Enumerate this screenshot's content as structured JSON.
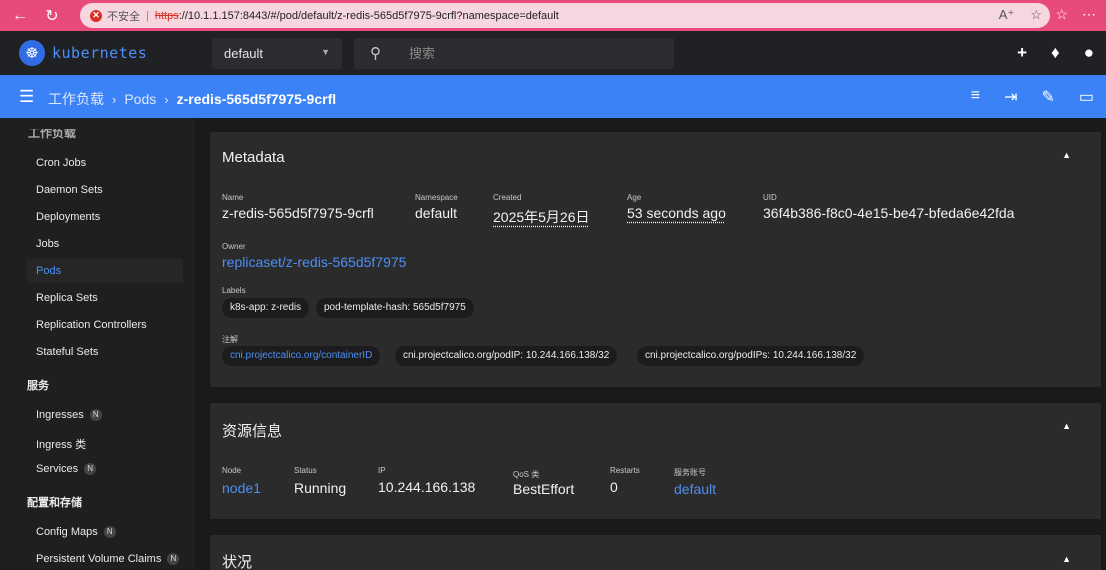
{
  "browser": {
    "security_text": "不安全",
    "url_scheme": "https",
    "url_rest": "://10.1.1.157:8443/#/pod/default/z-redis-565d5f7975-9crfl?namespace=default"
  },
  "header": {
    "logo_text": "kubernetes",
    "namespace": "default",
    "search_placeholder": "搜索"
  },
  "toolbar": {
    "breadcrumbs": [
      "工作负载",
      "Pods",
      "z-redis-565d5f7975-9crfl"
    ]
  },
  "sidebar": {
    "cut_section": "工作负载",
    "workloads": [
      "Cron Jobs",
      "Daemon Sets",
      "Deployments",
      "Jobs",
      "Pods",
      "Replica Sets",
      "Replication Controllers",
      "Stateful Sets"
    ],
    "active": "Pods",
    "service_section": "服务",
    "services": [
      "Ingresses",
      "Ingress 类",
      "Services"
    ],
    "config_section": "配置和存储",
    "config": [
      "Config Maps",
      "Persistent Volume Claims"
    ],
    "badge": "N"
  },
  "metadata": {
    "title": "Metadata",
    "name_label": "Name",
    "name": "z-redis-565d5f7975-9crfl",
    "namespace_label": "Namespace",
    "namespace": "default",
    "created_label": "Created",
    "created": "2025年5月26日",
    "age_label": "Age",
    "age": "53 seconds ago",
    "uid_label": "UID",
    "uid": "36f4b386-f8c0-4e15-be47-bfeda6e42fda",
    "owner_label": "Owner",
    "owner": "replicaset/z-redis-565d5f7975",
    "labels_label": "Labels",
    "labels": [
      "k8s-app: z-redis",
      "pod-template-hash: 565d5f7975"
    ],
    "annotations_label": "注解",
    "annotations": [
      "cni.projectcalico.org/containerID",
      "cni.projectcalico.org/podIP: 10.244.166.138/32",
      "cni.projectcalico.org/podIPs: 10.244.166.138/32"
    ]
  },
  "resource": {
    "title": "资源信息",
    "node_label": "Node",
    "node": "node1",
    "status_label": "Status",
    "status": "Running",
    "ip_label": "IP",
    "ip": "10.244.166.138",
    "qos_label": "QoS 类",
    "qos": "BestEffort",
    "restarts_label": "Restarts",
    "restarts": "0",
    "sa_label": "服务账号",
    "sa": "default"
  },
  "conditions": {
    "title": "状况"
  }
}
